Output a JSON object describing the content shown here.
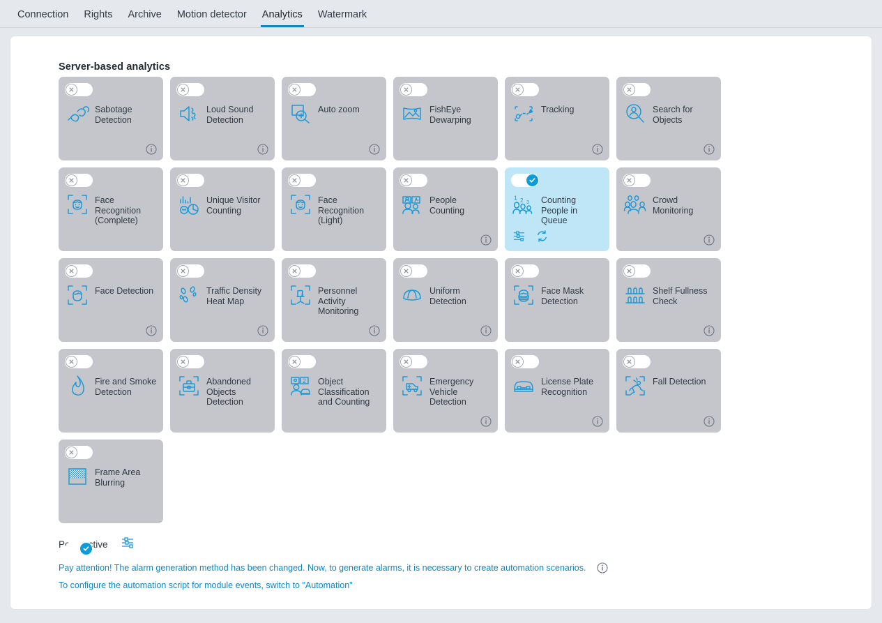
{
  "tabs": [
    {
      "label": "Connection",
      "active": false
    },
    {
      "label": "Rights",
      "active": false
    },
    {
      "label": "Archive",
      "active": false
    },
    {
      "label": "Motion detector",
      "active": false
    },
    {
      "label": "Analytics",
      "active": true
    },
    {
      "label": "Watermark",
      "active": false
    }
  ],
  "section": {
    "title": "Server-based analytics"
  },
  "colors": {
    "accent": "#0e88c4",
    "toggle_on": "#0e9cd8",
    "card_bg": "#c5c6cc",
    "card_active_bg": "#bfe6f7",
    "icon_blue": "#1c9ad6",
    "page_bg": "#e5e8ec",
    "text": "#2f3a45"
  },
  "cards": [
    {
      "label": "Sabotage Detection",
      "icon": "sabotage-icon",
      "enabled": false,
      "info": true
    },
    {
      "label": "Loud Sound Detection",
      "icon": "loud-sound-icon",
      "enabled": false,
      "info": true
    },
    {
      "label": "Auto zoom",
      "icon": "auto-zoom-icon",
      "enabled": false,
      "info": true
    },
    {
      "label": "FishEye Dewarping",
      "icon": "fisheye-dewarping-icon",
      "enabled": false,
      "info": false
    },
    {
      "label": "Tracking",
      "icon": "tracking-icon",
      "enabled": false,
      "info": true
    },
    {
      "label": "Search for Objects",
      "icon": "search-objects-icon",
      "enabled": false,
      "info": true
    },
    {
      "label": "Face Recognition (Complete)",
      "icon": "face-recognition-icon",
      "enabled": false,
      "info": false
    },
    {
      "label": "Unique Visitor Counting",
      "icon": "unique-visitor-icon",
      "enabled": false,
      "info": false
    },
    {
      "label": "Face Recognition (Light)",
      "icon": "face-recognition-icon",
      "enabled": false,
      "info": false
    },
    {
      "label": "People Counting",
      "icon": "people-counting-icon",
      "enabled": false,
      "info": true
    },
    {
      "label": "Counting People in Queue",
      "icon": "queue-counting-icon",
      "enabled": true,
      "info": false,
      "actions": [
        "settings-icon",
        "refresh-icon"
      ]
    },
    {
      "label": "Crowd Monitoring",
      "icon": "crowd-monitoring-icon",
      "enabled": false,
      "info": true
    },
    {
      "label": "Face Detection",
      "icon": "face-detection-icon",
      "enabled": false,
      "info": true
    },
    {
      "label": "Traffic Density Heat Map",
      "icon": "heat-map-icon",
      "enabled": false,
      "info": true
    },
    {
      "label": "Personnel Activity Monitoring",
      "icon": "personnel-activity-icon",
      "enabled": false,
      "info": true
    },
    {
      "label": "Uniform Detection",
      "icon": "uniform-detection-icon",
      "enabled": false,
      "info": true
    },
    {
      "label": "Face Mask Detection",
      "icon": "face-mask-icon",
      "enabled": false,
      "info": false
    },
    {
      "label": "Shelf Fullness Check",
      "icon": "shelf-fullness-icon",
      "enabled": false,
      "info": true
    },
    {
      "label": "Fire and Smoke Detection",
      "icon": "fire-smoke-icon",
      "enabled": false,
      "info": false
    },
    {
      "label": "Abandoned Objects Detection",
      "icon": "abandoned-objects-icon",
      "enabled": false,
      "info": false
    },
    {
      "label": "Object Classification and Counting",
      "icon": "object-classification-icon",
      "enabled": false,
      "info": false
    },
    {
      "label": "Emergency Vehicle Detection",
      "icon": "emergency-vehicle-icon",
      "enabled": false,
      "info": true
    },
    {
      "label": "License Plate Recognition",
      "icon": "license-plate-icon",
      "enabled": false,
      "info": true
    },
    {
      "label": "Fall Detection",
      "icon": "fall-detection-icon",
      "enabled": false,
      "info": true
    },
    {
      "label": "Frame Area Blurring",
      "icon": "frame-blur-icon",
      "enabled": false,
      "info": false
    }
  ],
  "perspective": {
    "label": "Perspective",
    "enabled": true,
    "settings_icon": "settings-sliders-icon"
  },
  "notice": {
    "line1": "Pay attention! The alarm generation method has been changed. Now, to generate alarms, it is necessary to create automation scenarios.",
    "line2": "To configure the automation script for module events, switch to \"Automation\"",
    "info_icon": "info-icon"
  }
}
